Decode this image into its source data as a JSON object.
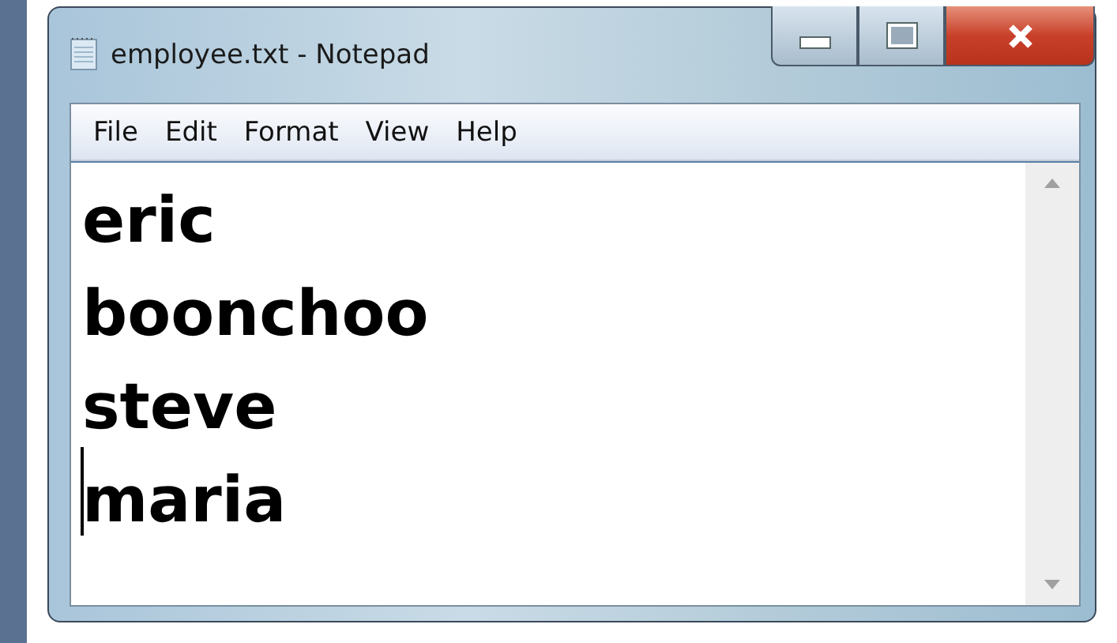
{
  "window": {
    "title": "employee.txt - Notepad"
  },
  "menu": [
    "File",
    "Edit",
    "Format",
    "View",
    "Help"
  ],
  "document": {
    "lines": [
      "eric",
      "boonchoo",
      "steve",
      "maria"
    ]
  }
}
